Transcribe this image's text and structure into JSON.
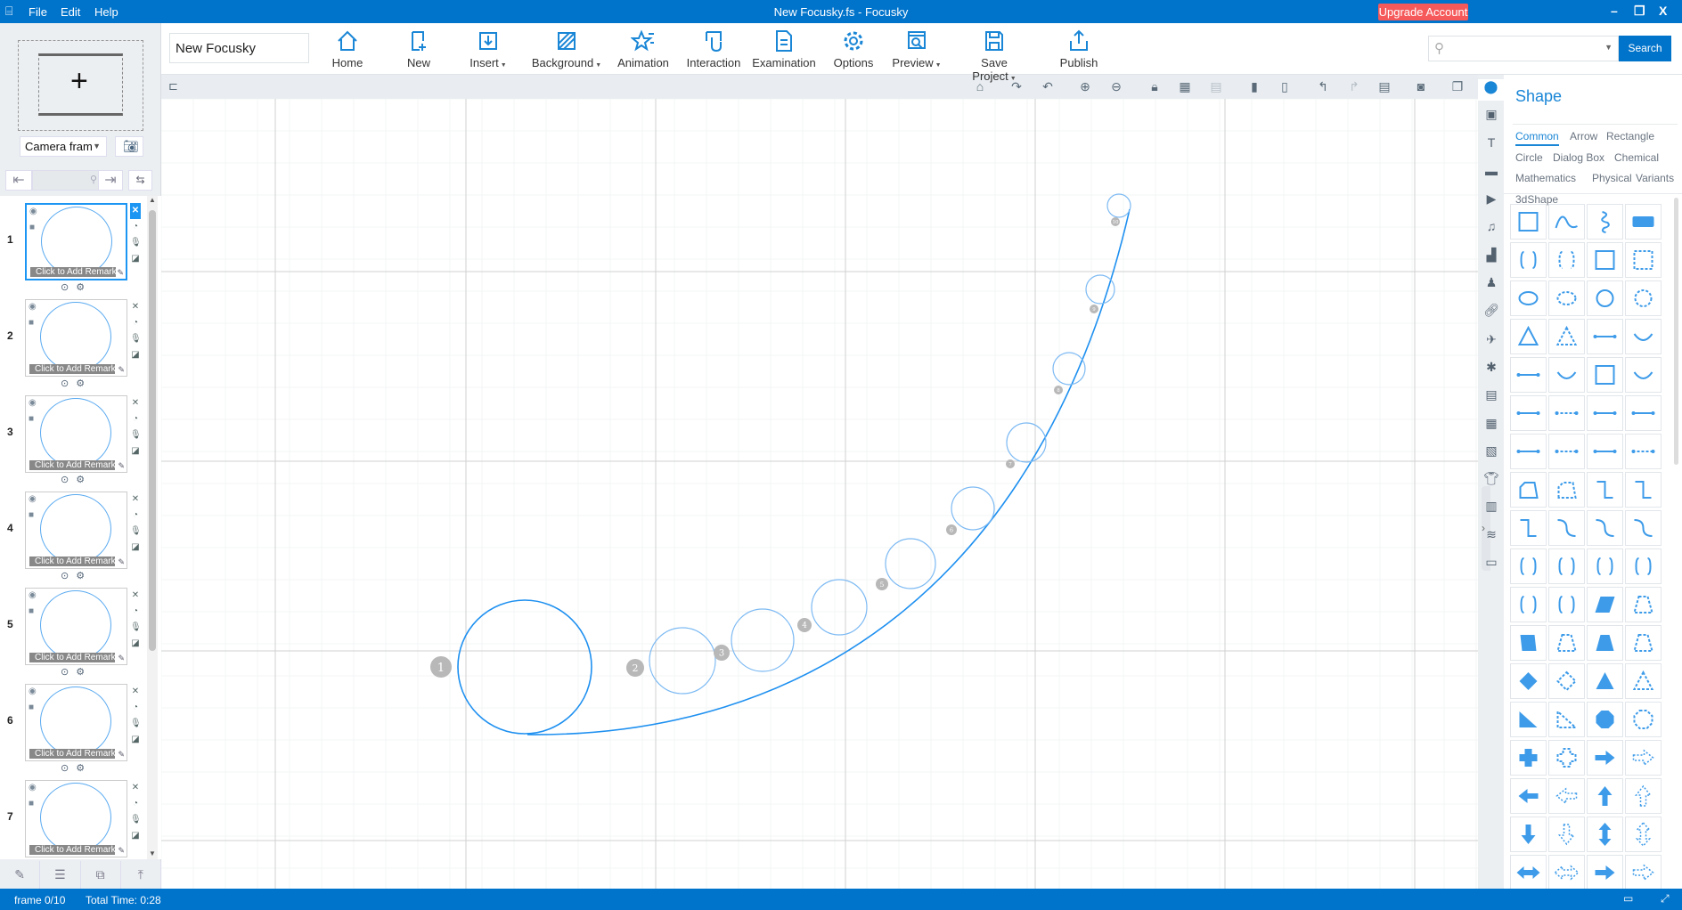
{
  "titlebar": {
    "menu": [
      "File",
      "Edit",
      "Help"
    ],
    "title": "New Focusky.fs - Focusky",
    "upgrade": "Upgrade Account"
  },
  "toolbar": {
    "project_name": "New Focusky",
    "buttons": [
      {
        "label": "Home",
        "icon": "home-icon"
      },
      {
        "label": "New",
        "icon": "new-page-icon"
      },
      {
        "label": "Insert",
        "icon": "insert-icon",
        "dropdown": true
      },
      {
        "label": "Background",
        "icon": "background-icon",
        "dropdown": true
      },
      {
        "label": "Animation",
        "icon": "animation-star-icon"
      },
      {
        "label": "Interaction",
        "icon": "interaction-hand-icon"
      },
      {
        "label": "Examination",
        "icon": "examination-doc-icon"
      },
      {
        "label": "Options",
        "icon": "gear-icon"
      },
      {
        "label": "Preview",
        "icon": "preview-icon",
        "dropdown": true
      },
      {
        "label": "Save Project",
        "icon": "save-icon",
        "dropdown": true
      },
      {
        "label": "Publish",
        "icon": "publish-icon"
      }
    ],
    "search_placeholder": "",
    "search_label": "Search"
  },
  "left": {
    "camera_select": "Camera fram",
    "frames": [
      {
        "num": "1",
        "remark": "Click to Add Remark",
        "selected": true
      },
      {
        "num": "2",
        "remark": "Click to Add Remark"
      },
      {
        "num": "3",
        "remark": "Click to Add Remark"
      },
      {
        "num": "4",
        "remark": "Click to Add Remark"
      },
      {
        "num": "5",
        "remark": "Click to Add Remark"
      },
      {
        "num": "6",
        "remark": "Click to Add Remark"
      },
      {
        "num": "7",
        "remark": "Click to Add Remark"
      }
    ]
  },
  "canvas_toolbar": [
    "home-icon",
    "rotate-right-icon",
    "rotate-left-icon",
    "zoom-in-icon",
    "zoom-out-icon",
    "lock-icon",
    "grid-icon",
    "align-icon",
    "copy-icon",
    "paste-icon",
    "undo-icon",
    "redo-icon",
    "history-icon",
    "screenshot-icon",
    "window-icon"
  ],
  "canvas": {
    "path_color": "#1e90f0",
    "frames": [
      "1",
      "2",
      "3",
      "4",
      "5",
      "6",
      "7",
      "8",
      "9",
      "10"
    ]
  },
  "right_strip": [
    "shape-icon",
    "image-icon",
    "text-icon",
    "speech-bubble-icon",
    "video-icon",
    "music-icon",
    "chart-icon",
    "people-icon",
    "link-icon",
    "plane-icon",
    "flash-icon",
    "document-icon",
    "gallery-icon",
    "widget-icon",
    "shirt-icon",
    "layout-icon",
    "layers-icon",
    "printer-icon"
  ],
  "panel": {
    "title": "Shape",
    "tabs": [
      [
        "Common",
        "Arrow",
        "Rectangle"
      ],
      [
        "Circle",
        "Dialog Box",
        "Chemical"
      ],
      [
        "Mathematics",
        "Physical",
        "Variants"
      ]
    ],
    "active_tab": "Common",
    "section": "3dShape",
    "shapes": [
      "corner-rect",
      "wave",
      "spring",
      "filled-rounded-rect",
      "brackets",
      "dashed-brackets",
      "square",
      "dotted-square",
      "ellipse",
      "dashed-ellipse",
      "circle",
      "dashed-circle",
      "triangle",
      "dashed-triangle",
      "line",
      "arc",
      "arrow-line",
      "curved-arrow",
      "double-arrow",
      "curved-double-arrow",
      "dot-line",
      "dash-dot-line",
      "diamond-line",
      "diamond-dot-line",
      "arrow-dot-line",
      "arrow-dash-line",
      "double-arrow-line",
      "double-dash-line",
      "blob",
      "dashed-blob",
      "step",
      "step-right",
      "elbow-arrow",
      "s-curve",
      "s-curve-arrow",
      "s-curve-double",
      "curly-braces",
      "left-brace",
      "right-brace",
      "parens",
      "left-bracket",
      "right-bracket",
      "parallelogram",
      "dashed-parallelogram",
      "trapezoid-left",
      "dashed-trapezoid-left",
      "trapezoid",
      "dashed-trapezoid",
      "diamond",
      "dashed-diamond",
      "filled-triangle",
      "dashed-triangle-2",
      "right-triangle",
      "dashed-right-triangle",
      "octagon",
      "dashed-octagon",
      "cross",
      "dashed-cross",
      "arrow-right",
      "dashed-arrow-right",
      "arrow-left",
      "dashed-arrow-left",
      "arrow-up",
      "dashed-arrow-up",
      "arrow-down",
      "dashed-arrow-down",
      "arrow-up-down",
      "dashed-arrow-up-down",
      "arrow-left-right",
      "dashed-arrow-left-right",
      "arrow-right-2",
      "dashed-arrow-right-2"
    ]
  },
  "status": {
    "frame": "frame 0/10",
    "total_time": "Total Time: 0:28"
  },
  "colors": {
    "brand": "#0073cb",
    "upgrade": "#f5595a",
    "accent": "#1a86d6"
  }
}
